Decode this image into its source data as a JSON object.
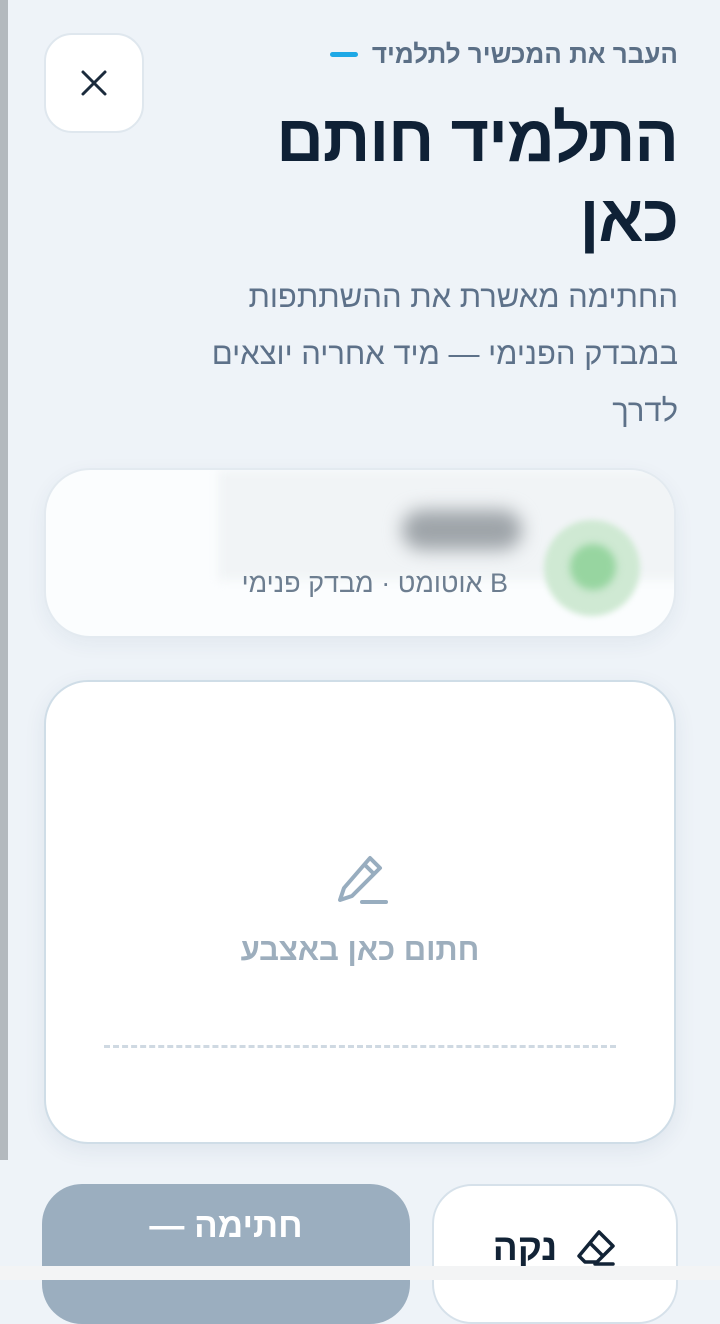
{
  "header": {
    "subtitle": "העבר את המכשיר לתלמיד",
    "title": "התלמיד חותם כאן",
    "description": "החתימה מאשרת את ההשתתפות במבדק הפנימי — מיד אחריה יוצאים לדרך",
    "accent_color": "#1ea8e6"
  },
  "close_button": {
    "icon": "close-icon"
  },
  "student_card": {
    "name": "",
    "meta": "B אוטומט · מבדק פנימי"
  },
  "signature_pad": {
    "icon": "pen-icon",
    "hint": "חתום כאן באצבע"
  },
  "actions": {
    "clear_label": "נקה",
    "clear_icon": "eraser-icon",
    "submit_label": "חתימה — "
  }
}
